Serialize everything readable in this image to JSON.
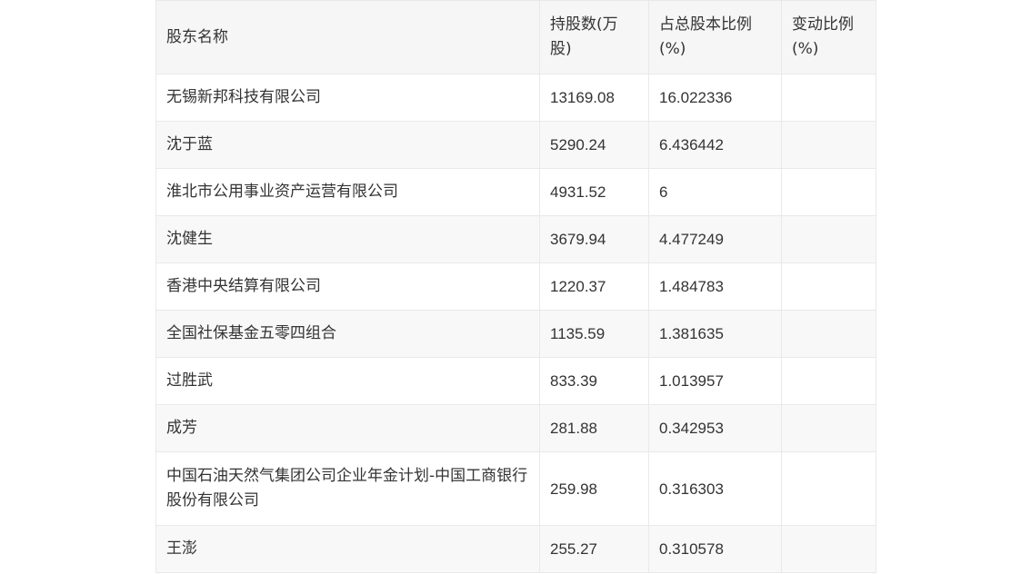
{
  "table": {
    "headers": {
      "name": "股东名称",
      "shares": "持股数(万股)",
      "ratio": "占总股本比例(%)",
      "change": "变动比例(%)"
    },
    "rows": [
      {
        "name": "无锡新邦科技有限公司",
        "shares": "13169.08",
        "ratio": "16.022336",
        "change": ""
      },
      {
        "name": "沈于蓝",
        "shares": "5290.24",
        "ratio": "6.436442",
        "change": ""
      },
      {
        "name": "淮北市公用事业资产运营有限公司",
        "shares": "4931.52",
        "ratio": "6",
        "change": ""
      },
      {
        "name": "沈健生",
        "shares": "3679.94",
        "ratio": "4.477249",
        "change": ""
      },
      {
        "name": "香港中央结算有限公司",
        "shares": "1220.37",
        "ratio": "1.484783",
        "change": ""
      },
      {
        "name": "全国社保基金五零四组合",
        "shares": "1135.59",
        "ratio": "1.381635",
        "change": ""
      },
      {
        "name": "过胜武",
        "shares": "833.39",
        "ratio": "1.013957",
        "change": ""
      },
      {
        "name": "成芳",
        "shares": "281.88",
        "ratio": "0.342953",
        "change": ""
      },
      {
        "name": "中国石油天然气集团公司企业年金计划-中国工商银行股份有限公司",
        "shares": "259.98",
        "ratio": "0.316303",
        "change": ""
      },
      {
        "name": "王澎",
        "shares": "255.27",
        "ratio": "0.310578",
        "change": ""
      }
    ]
  }
}
